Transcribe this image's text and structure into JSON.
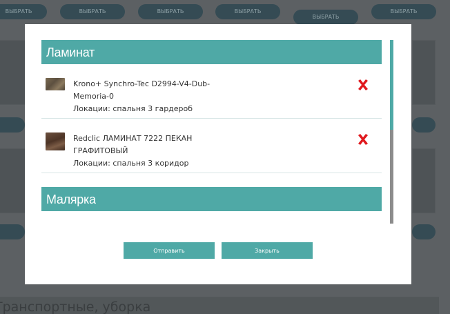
{
  "background": {
    "buttons": [
      "ВЫБРАТЬ",
      "ВЫБРАТЬ",
      "ВЫБРАТЬ",
      "ВЫБРАТЬ",
      "ВЫБРАТЬ",
      "ВЫБРАТЬ"
    ],
    "footer_text": "Транспортные, уборка"
  },
  "modal": {
    "sections": [
      {
        "title": "Ламинат",
        "items": [
          {
            "name": "Krono+ Synchro-Tec D2994-V4-Dub-Memoria-0",
            "location": "Локации: спальня 3 гардероб",
            "remove_icon": "red-x-icon"
          },
          {
            "name": "Redclic ЛАМИНАТ 7222 ПЕКАН ГРАФИТОВЫЙ",
            "location": "Локации: спальня 3 коридор",
            "remove_icon": "red-x-icon"
          }
        ]
      },
      {
        "title": "Малярка",
        "items": []
      }
    ],
    "buttons": {
      "send_label": "Отправить",
      "close_label": "Закрыть"
    }
  },
  "colors": {
    "accent": "#4fa9a6",
    "remove": "#e0191e",
    "overlay": "#5c6063"
  }
}
